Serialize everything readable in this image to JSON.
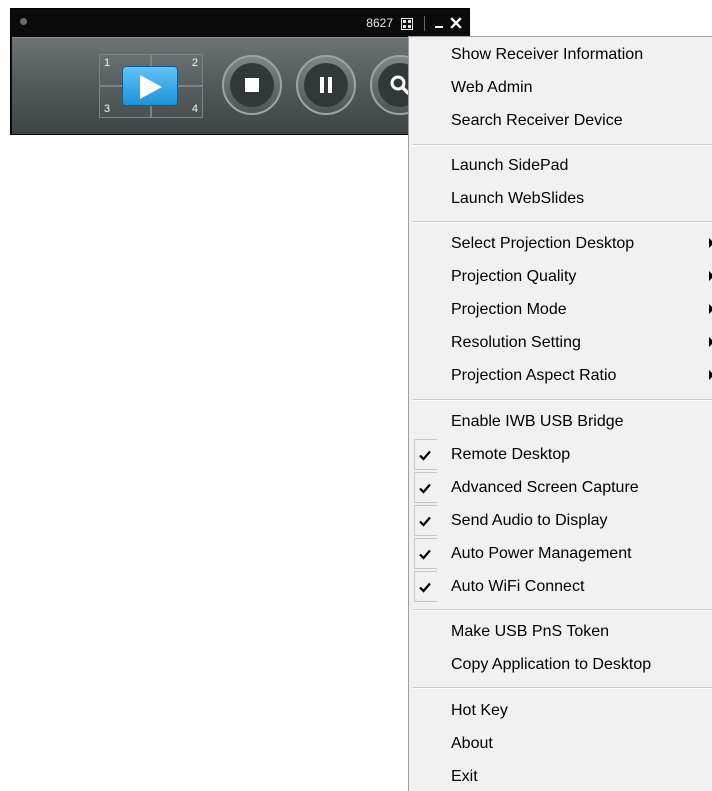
{
  "toolbar": {
    "code": "8627",
    "quad_numbers": [
      "1",
      "2",
      "3",
      "4"
    ],
    "icons": {
      "grid": "grid-icon",
      "minimize": "minimize-icon",
      "close": "close-icon",
      "play": "play-icon",
      "stop": "stop-icon",
      "pause": "pause-icon",
      "search": "search-icon"
    },
    "colors": {
      "play_accent": "#2aa6ec",
      "bar_dark": "#0b0b0b",
      "bar_gradient_top": "#6e7475"
    }
  },
  "context_menu": {
    "items": [
      {
        "label": "Show Receiver Information"
      },
      {
        "label": "Web Admin"
      },
      {
        "label": "Search Receiver Device"
      },
      {
        "label": "Launch SidePad"
      },
      {
        "label": "Launch WebSlides"
      },
      {
        "label": "Select Projection Desktop",
        "submenu": true
      },
      {
        "label": "Projection Quality",
        "submenu": true
      },
      {
        "label": "Projection Mode",
        "submenu": true
      },
      {
        "label": "Resolution Setting",
        "submenu": true
      },
      {
        "label": "Projection Aspect Ratio",
        "submenu": true
      },
      {
        "label": "Enable IWB USB Bridge"
      },
      {
        "label": "Remote Desktop",
        "checked": true
      },
      {
        "label": "Advanced Screen Capture",
        "checked": true
      },
      {
        "label": "Send Audio to Display",
        "checked": true
      },
      {
        "label": "Auto Power Management",
        "checked": true
      },
      {
        "label": "Auto WiFi Connect",
        "checked": true
      },
      {
        "label": "Make USB PnS Token"
      },
      {
        "label": "Copy Application to Desktop"
      },
      {
        "label": "Hot Key"
      },
      {
        "label": "About"
      },
      {
        "label": "Exit"
      }
    ]
  }
}
